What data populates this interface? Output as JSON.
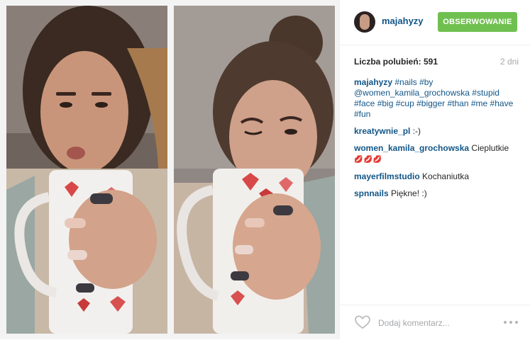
{
  "post": {
    "username": "majahyzy",
    "follow_label": "OBSERWOWANIE",
    "likes_label": "Liczba polubień: 591",
    "time_ago": "2 dni",
    "caption": {
      "user": "majahyzy",
      "tags": [
        "#nails",
        "#by",
        "@women_kamila_grochowska",
        "#stupid",
        "#face",
        "#big",
        "#cup",
        "#bigger",
        "#than",
        "#me",
        "#have",
        "#fun"
      ]
    },
    "comments": [
      {
        "user": "kreatywnie_pl",
        "text": ":-)"
      },
      {
        "user": "women_kamila_grochowska",
        "text": "Cieplutkie",
        "emoji": "💋💋💋"
      },
      {
        "user": "mayerfilmstudio",
        "text": "Kochaniutka"
      },
      {
        "user": "spnnails",
        "text": "Piękne! :)"
      }
    ],
    "comment_placeholder": "Dodaj komentarz...",
    "icons": {
      "like": "heart-outline-icon",
      "more": "ellipsis-icon"
    }
  },
  "colors": {
    "link": "#125688",
    "follow_button": "#70c050",
    "muted": "#a5a7aa"
  }
}
